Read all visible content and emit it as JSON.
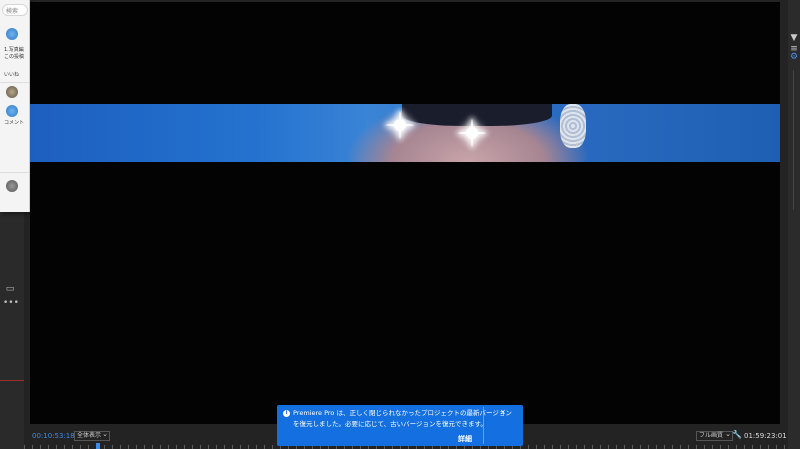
{
  "floating_panel": {
    "search_placeholder": "検索",
    "comment_line1": "1.写真編",
    "comment_line2": "この投稿",
    "comment_line3": "いいね",
    "comment_line4": "コメント"
  },
  "controls": {
    "timecode_left": "00:10:53:18",
    "zoom_label": "全体表示",
    "quality_label": "フル画質",
    "timecode_right": "01:59:23:01"
  },
  "toast": {
    "message_line1": "Premiere Pro は、正しく閉じられなかったプロジェクトの最新バージョン",
    "message_line2": "を復元しました。必要に応じて、古いバージョンを復元できます。",
    "close_label": "×",
    "detail_label": "詳細",
    "info_glyph": "i"
  },
  "right_toolbar": {
    "filter_glyph": "▼",
    "menu_glyph": "≡"
  },
  "left_toolbar": {
    "more_glyph": "•••"
  },
  "colors": {
    "accent_blue": "#1470e0",
    "timecode_blue": "#3d8ce8",
    "monitor_bg": "#030303"
  }
}
